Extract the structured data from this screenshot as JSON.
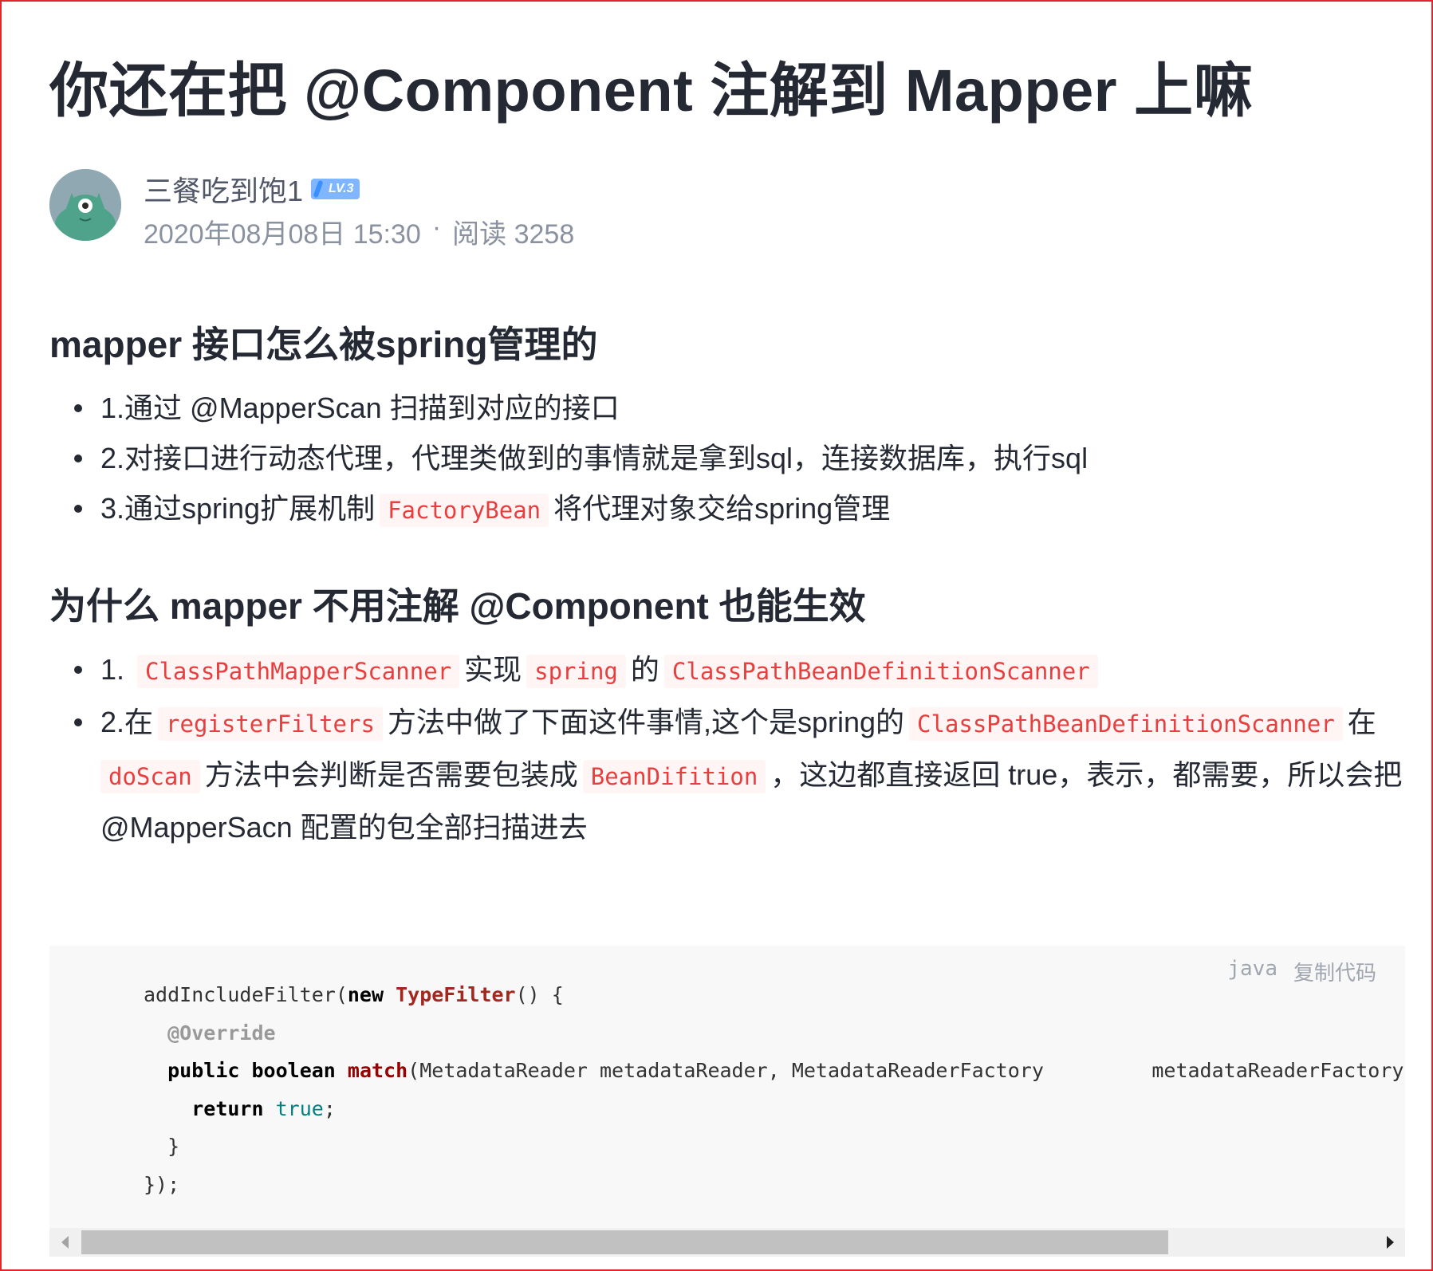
{
  "article": {
    "title": "你还在把 @Component 注解到 Mapper 上嘛",
    "author": {
      "name": "三餐吃到饱1",
      "level": "LV.3",
      "date": "2020年08月08日 15:30",
      "separator": "·",
      "reads": "阅读 3258"
    },
    "sections": [
      {
        "heading": "mapper 接口怎么被spring管理的",
        "items": [
          {
            "text": "1.通过 @MapperScan 扫描到对应的接口"
          },
          {
            "text": "2.对接口进行动态代理，代理类做到的事情就是拿到sql，连接数据库，执行sql"
          },
          {
            "prefix": "3.通过spring扩展机制",
            "code": "FactoryBean",
            "suffix": "将代理对象交给spring管理"
          }
        ]
      },
      {
        "heading": "为什么 mapper 不用注解 @Component 也能生效",
        "item1": {
          "num": "1.",
          "code1": "ClassPathMapperScanner",
          "text1": "实现",
          "code2": "spring",
          "text2": "的",
          "code3": "ClassPathBeanDefinitionScanner"
        },
        "item2": {
          "prefix": "2.在",
          "code1": "registerFilters",
          "text1": "方法中做了下面这件事情,这个是spring的",
          "code2": "ClassPathBeanDefinitionScanner",
          "text2": "在",
          "code3": "doScan",
          "text3": "方法中会判断是否需要包装成",
          "code4": "BeanDifition",
          "text4": "，这边都直接返回 true，表示，都需要，所以会把",
          "text5": "@MapperSacn 配置的包全部扫描进去"
        }
      }
    ]
  },
  "codeblock": {
    "language": "java",
    "copy_label": "复制代码",
    "lines": {
      "l1_a": "addIncludeFilter(",
      "l1_kw": "new",
      "l1_ty": "TypeFilter",
      "l1_b": "() {",
      "l2_an": "@Override",
      "l3_kw1": "public",
      "l3_kw2": "boolean",
      "l3_fn": "match",
      "l3_rest": "(MetadataReader metadataReader, MetadataReaderFactory         metadataReaderFactory)",
      "l4_kw": "return",
      "l4_lit": "true",
      "l4_end": ";",
      "l5": "}",
      "l6": "});"
    }
  },
  "colors": {
    "frame_border": "#e0262c",
    "text": "#252933",
    "meta": "#8a919f",
    "inline_code": "#e83e3e",
    "code_bg": "#f8f8f8",
    "level_badge": "#7fb6ff"
  }
}
